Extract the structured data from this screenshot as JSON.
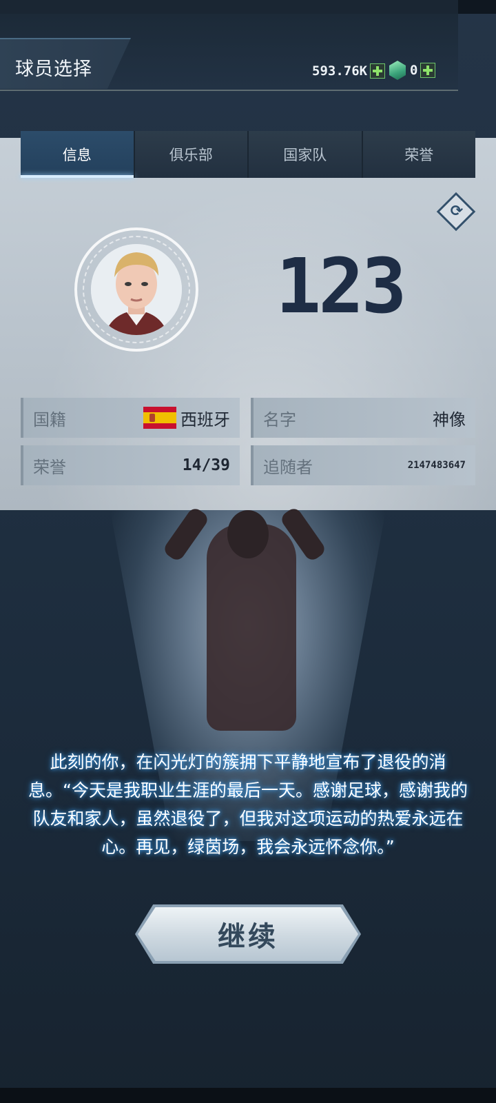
{
  "header": {
    "title": "球员选择",
    "coins": "593.76K",
    "gems": "0"
  },
  "tabs": [
    {
      "label": "信息",
      "active": true
    },
    {
      "label": "俱乐部",
      "active": false
    },
    {
      "label": "国家队",
      "active": false
    },
    {
      "label": "荣誉",
      "active": false
    }
  ],
  "player": {
    "number": "123",
    "nationality_label": "国籍",
    "nationality_value": "西班牙",
    "name_label": "名字",
    "name_value": "神像",
    "honors_label": "荣誉",
    "honors_value": "14/39",
    "followers_label": "追随者",
    "followers_value": "2147483647"
  },
  "story": "此刻的你，在闪光灯的簇拥下平静地宣布了退役的消息。“今天是我职业生涯的最后一天。感谢足球，感谢我的队友和家人，虽然退役了，但我对这项运动的热爱永远在心。再见，绿茵场，我会永远怀念你。”",
  "continue_label": "继续",
  "icons": {
    "swap": "swap-arrows-icon",
    "coin_add": "plus-icon",
    "gem": "gem-icon",
    "flag": "spain-flag-icon"
  },
  "colors": {
    "accent": "#8ee36a",
    "text_glow": "#3ea7ff",
    "number": "#1e2d45"
  }
}
